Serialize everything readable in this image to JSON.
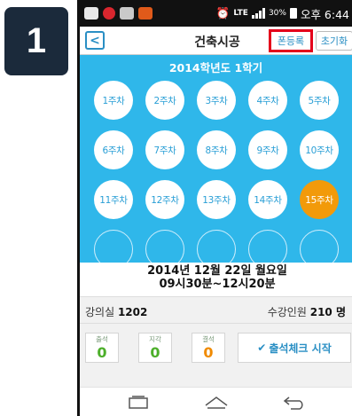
{
  "step": {
    "number": "1"
  },
  "status_bar": {
    "battery": "30%",
    "time": "오후 6:44",
    "icons": [
      "app-notification-icon",
      "app-notification-icon",
      "app-notification-icon",
      "app-notification-icon",
      "alarm-icon",
      "lte-icon",
      "signal-icon",
      "battery-icon"
    ]
  },
  "app_bar": {
    "back_label": "<",
    "title": "건축시공",
    "register_font_label": "폰등록",
    "reset_label": "초기화"
  },
  "semester": "2014학년도 1학기",
  "weeks": [
    {
      "label": "1주차",
      "state": "normal"
    },
    {
      "label": "2주차",
      "state": "normal"
    },
    {
      "label": "3주차",
      "state": "normal"
    },
    {
      "label": "4주차",
      "state": "normal"
    },
    {
      "label": "5주차",
      "state": "normal"
    },
    {
      "label": "6주차",
      "state": "normal"
    },
    {
      "label": "7주차",
      "state": "normal"
    },
    {
      "label": "8주차",
      "state": "normal"
    },
    {
      "label": "9주차",
      "state": "normal"
    },
    {
      "label": "10주차",
      "state": "normal"
    },
    {
      "label": "11주차",
      "state": "normal"
    },
    {
      "label": "12주차",
      "state": "normal"
    },
    {
      "label": "13주차",
      "state": "normal"
    },
    {
      "label": "14주차",
      "state": "normal"
    },
    {
      "label": "15주차",
      "state": "active"
    },
    {
      "label": "",
      "state": "empty"
    },
    {
      "label": "",
      "state": "empty"
    },
    {
      "label": "",
      "state": "empty"
    },
    {
      "label": "",
      "state": "empty"
    },
    {
      "label": "",
      "state": "empty"
    }
  ],
  "session": {
    "date": "2014년 12월 22일 월요일",
    "time": "09시30분~12시20분"
  },
  "info": {
    "room_label": "강의실",
    "room_value": "1202",
    "capacity_label": "수강인원",
    "capacity_value": "210 명"
  },
  "stats": [
    {
      "label": "출석",
      "value": "0",
      "color": "#4caf2a"
    },
    {
      "label": "지각",
      "value": "0",
      "color": "#4caf2a"
    },
    {
      "label": "결석",
      "value": "0",
      "color": "#f08a00"
    }
  ],
  "attendance_button": {
    "icon": "✔",
    "label": "출석체크 시작"
  },
  "colors": {
    "background": "#2fb7ea",
    "active_week": "#f29a0a",
    "highlight_border": "#e4001b",
    "accent": "#2a8fc4"
  }
}
